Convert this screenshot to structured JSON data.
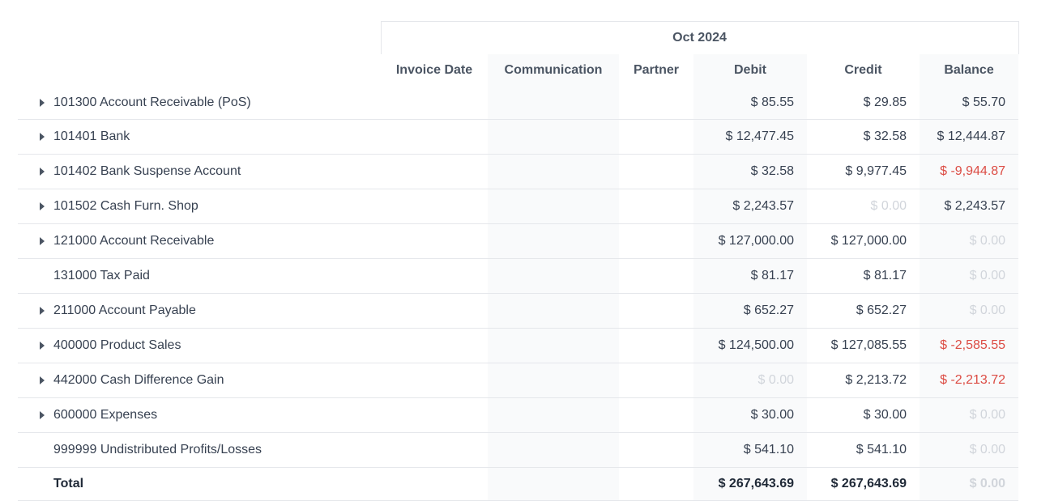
{
  "period": "Oct 2024",
  "columns": {
    "invoice_date": "Invoice Date",
    "communication": "Communication",
    "partner": "Partner",
    "debit": "Debit",
    "credit": "Credit",
    "balance": "Balance"
  },
  "rows": [
    {
      "account": "101300 Account Receivable (PoS)",
      "expandable": true,
      "debit": "$ 85.55",
      "credit": "$ 29.85",
      "balance": "$ 55.70"
    },
    {
      "account": "101401 Bank",
      "expandable": true,
      "debit": "$ 12,477.45",
      "credit": "$ 32.58",
      "balance": "$ 12,444.87"
    },
    {
      "account": "101402 Bank Suspense Account",
      "expandable": true,
      "debit": "$ 32.58",
      "credit": "$ 9,977.45",
      "balance": "$ -9,944.87"
    },
    {
      "account": "101502 Cash Furn. Shop",
      "expandable": true,
      "debit": "$ 2,243.57",
      "credit": "$ 0.00",
      "balance": "$ 2,243.57"
    },
    {
      "account": "121000 Account Receivable",
      "expandable": true,
      "debit": "$ 127,000.00",
      "credit": "$ 127,000.00",
      "balance": "$ 0.00"
    },
    {
      "account": "131000 Tax Paid",
      "expandable": false,
      "debit": "$ 81.17",
      "credit": "$ 81.17",
      "balance": "$ 0.00"
    },
    {
      "account": "211000 Account Payable",
      "expandable": true,
      "debit": "$ 652.27",
      "credit": "$ 652.27",
      "balance": "$ 0.00"
    },
    {
      "account": "400000 Product Sales",
      "expandable": true,
      "debit": "$ 124,500.00",
      "credit": "$ 127,085.55",
      "balance": "$ -2,585.55"
    },
    {
      "account": "442000 Cash Difference Gain",
      "expandable": true,
      "debit": "$ 0.00",
      "credit": "$ 2,213.72",
      "balance": "$ -2,213.72"
    },
    {
      "account": "600000 Expenses",
      "expandable": true,
      "debit": "$ 30.00",
      "credit": "$ 30.00",
      "balance": "$ 0.00"
    },
    {
      "account": "999999 Undistributed Profits/Losses",
      "expandable": false,
      "debit": "$ 541.10",
      "credit": "$ 541.10",
      "balance": "$ 0.00"
    }
  ],
  "total": {
    "label": "Total",
    "debit": "$ 267,643.69",
    "credit": "$ 267,643.69",
    "balance": "$ 0.00"
  },
  "colors": {
    "negative": "#dc4c44",
    "muted": "#d1d5db",
    "text": "#374151"
  }
}
